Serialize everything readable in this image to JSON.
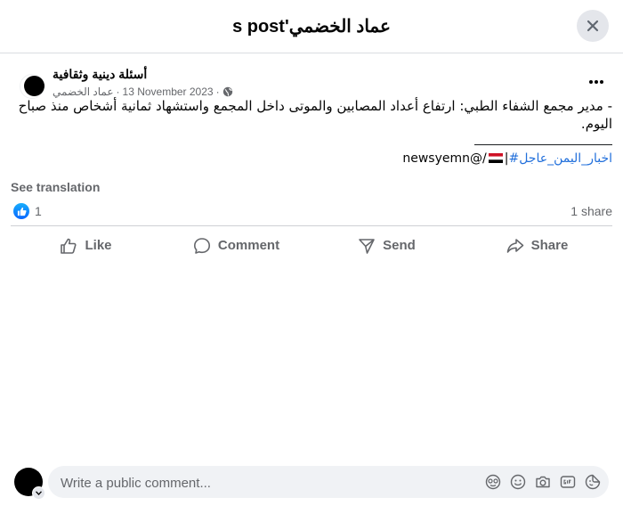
{
  "header": {
    "title": "s post'عماد الخضمي"
  },
  "post": {
    "page_name": "أسئلة دينية وثقافية",
    "author": "عماد الخضمي",
    "separator": "·",
    "date": "13 November 2023",
    "text": "- مدير مجمع الشفاء الطبي: ارتفاع أعداد المصابين والموتى داخل المجمع واستشهاد ثمانية أشخاص منذ صباح اليوم.",
    "hashtag": "#اخبار_اليمن_عاجل",
    "handle": "newsyemn@/",
    "see_translation": "See translation",
    "like_count": "1",
    "share_count": "1 share"
  },
  "actions": {
    "like": "Like",
    "comment": "Comment",
    "send": "Send",
    "share": "Share"
  },
  "composer": {
    "placeholder": "Write a public comment..."
  },
  "colors": {
    "accent": "#0866ff",
    "link": "#216fdb",
    "muted": "#65676b"
  }
}
